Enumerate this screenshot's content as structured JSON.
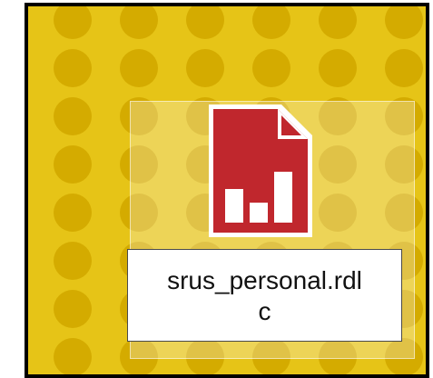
{
  "desktop": {
    "background_color": "#e6c417",
    "dot_color": "#d4ab00",
    "selection_tint": "#f1ea94"
  },
  "file": {
    "name_line1": "srus_personal.rdl",
    "name_line2": "c",
    "icon": "report-file-icon",
    "icon_color": "#c0272d"
  }
}
